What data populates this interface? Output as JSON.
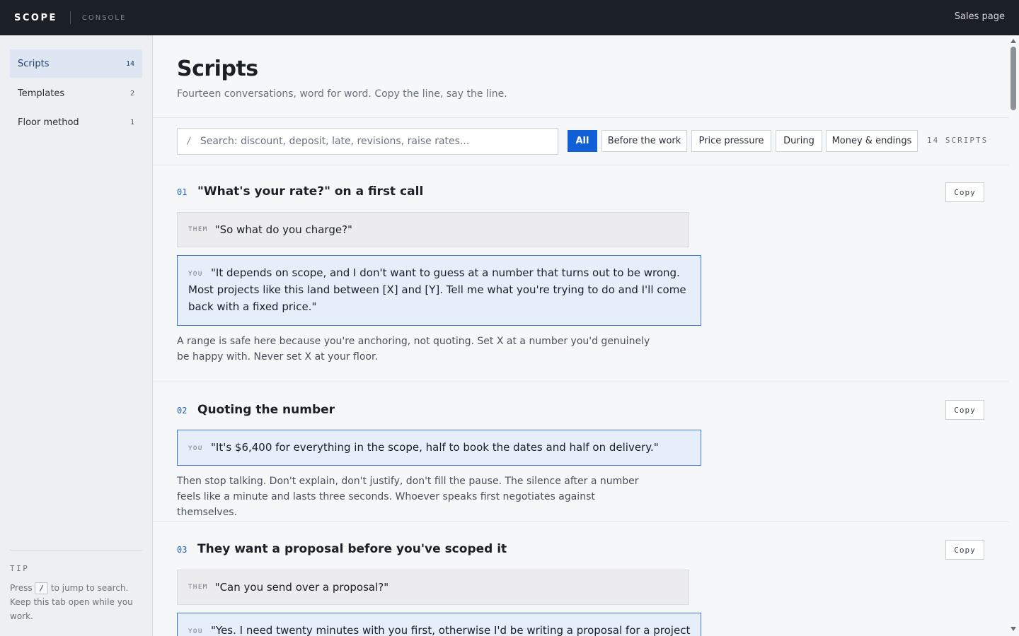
{
  "topbar": {
    "brand": "SCOPE",
    "sub": "CONSOLE",
    "link": "Sales page"
  },
  "sidebar": {
    "items": [
      {
        "label": "Scripts",
        "count": "14",
        "active": true
      },
      {
        "label": "Templates",
        "count": "2"
      },
      {
        "label": "Floor method",
        "count": "1"
      }
    ],
    "tip": {
      "title": "TIP",
      "press": "Press",
      "key": "/",
      "rest": "to jump to search. Keep this tab open while you work."
    }
  },
  "header": {
    "title": "Scripts",
    "subtitle": "Fourteen conversations, word for word. Copy the line, say the line."
  },
  "search": {
    "slash": "/",
    "placeholder": "Search: discount, deposit, late, revisions, raise rates..."
  },
  "filters": [
    {
      "label": "All",
      "active": true
    },
    {
      "label": "Before the work"
    },
    {
      "label": "Price pressure"
    },
    {
      "label": "During"
    },
    {
      "label": "Money & endings"
    }
  ],
  "count_label": "14 SCRIPTS",
  "scripts": [
    {
      "num": "01",
      "title": "\"What's your rate?\" on a first call",
      "copy": "Copy",
      "them_tag": "THEM",
      "them": "\"So what do you charge?\"",
      "you_tag": "YOU",
      "you": "\"It depends on scope, and I don't want to guess at a number that turns out to be wrong. Most projects like this land between [X] and [Y]. Tell me what you're trying to do and I'll come back with a fixed price.\"",
      "note": "A range is safe here because you're anchoring, not quoting. Set X at a number you'd genuinely be happy with. Never set X at your floor."
    },
    {
      "num": "02",
      "title": "Quoting the number",
      "copy": "Copy",
      "you_tag": "YOU",
      "you": "\"It's $6,400 for everything in the scope, half to book the dates and half on delivery.\"",
      "note": "Then stop talking. Don't explain, don't justify, don't fill the pause. The silence after a number feels like a minute and lasts three seconds. Whoever speaks first negotiates against themselves."
    },
    {
      "num": "03",
      "title": "They want a proposal before you've scoped it",
      "copy": "Copy",
      "them_tag": "THEM",
      "them": "\"Can you send over a proposal?\"",
      "you_tag": "YOU",
      "you": "\"Yes. I need twenty minutes with you first, otherwise I'd be writing a proposal for a project"
    }
  ]
}
